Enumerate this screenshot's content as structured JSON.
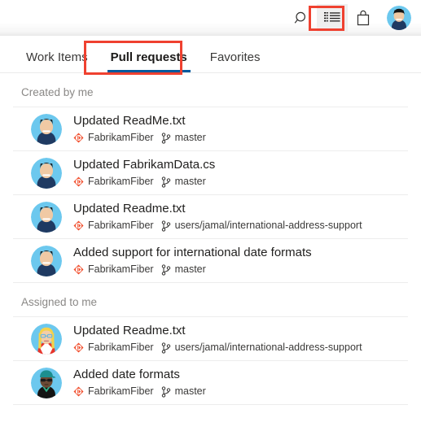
{
  "topbar": {
    "icons": [
      {
        "name": "search-icon",
        "label": "Search"
      },
      {
        "name": "feed-icon",
        "label": "My work / Feed"
      },
      {
        "name": "marketplace-bag-icon",
        "label": "Marketplace"
      }
    ],
    "avatar_label": "User profile",
    "highlight_color": "#ef4130"
  },
  "tabs": [
    {
      "label": "Work Items",
      "selected": false
    },
    {
      "label": "Pull requests",
      "selected": true
    },
    {
      "label": "Favorites",
      "selected": false
    }
  ],
  "tab_accent_color": "#005a9e",
  "sections": [
    {
      "title": "Created by me",
      "items": [
        {
          "title": "Updated ReadMe.txt",
          "repo": "FabrikamFiber",
          "branch": "master",
          "avatar": "male-black-hair"
        },
        {
          "title": "Updated FabrikamData.cs",
          "repo": "FabrikamFiber",
          "branch": "master",
          "avatar": "male-black-hair"
        },
        {
          "title": "Updated Readme.txt",
          "repo": "FabrikamFiber",
          "branch": "users/jamal/international-address-support",
          "avatar": "male-black-hair"
        },
        {
          "title": "Added support for international date formats",
          "repo": "FabrikamFiber",
          "branch": "master",
          "avatar": "male-black-hair"
        }
      ]
    },
    {
      "title": "Assigned to me",
      "items": [
        {
          "title": "Updated Readme.txt",
          "repo": "FabrikamFiber",
          "branch": "users/jamal/international-address-support",
          "avatar": "female-blonde-glasses"
        },
        {
          "title": "Added date formats",
          "repo": "FabrikamFiber",
          "branch": "master",
          "avatar": "person-teal-cap"
        }
      ]
    }
  ],
  "icons": {
    "repo_icon_name": "azure-repos-icon",
    "repo_icon_color": "#f1502f",
    "branch_icon_name": "git-branch-icon"
  }
}
